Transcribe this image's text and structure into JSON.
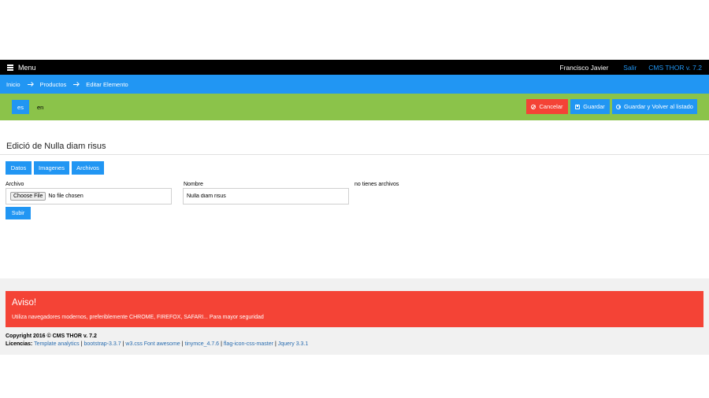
{
  "navbar": {
    "menu_label": "Menu",
    "user_name": "Francisco Javier",
    "logout_label": "Salir",
    "version_label": "CMS THOR v. 7.2",
    "link_color": "#2196f3"
  },
  "breadcrumb": {
    "items": [
      "Inicio",
      "Productos",
      "Editar Elemento"
    ],
    "bg_color": "#2196f3"
  },
  "actionbar": {
    "bg_color": "#8bc34a",
    "languages": [
      "es",
      "en"
    ],
    "active_language": "es",
    "cancel_label": "Cancelar",
    "save_label": "Guardar",
    "save_back_label": "Guardar y Volver al listado"
  },
  "main": {
    "title": "Edició de Nulla diam risus",
    "tabs": [
      "Datos",
      "Imagenes",
      "Archivos"
    ],
    "file_label": "Archivo",
    "file_button": "Choose File",
    "file_status": "No file chosen",
    "name_label": "Nombre",
    "name_value": "Nulla diam risus",
    "no_files_text": "no tienes archivos",
    "upload_label": "Subir"
  },
  "footer": {
    "alert_title": "Aviso!",
    "alert_text": "Utiliza navegadores modernos, preferiblemente CHROME, FIREFOX, SAFARI... Para mayor seguridad",
    "alert_color": "#f44336",
    "copyright": "Copyright 2016 © CMS THOR v. 7.2",
    "licenses_label": "Licencias:",
    "licenses": [
      "Template analytics",
      "bootstrap-3.3.7",
      "w3.css Font awesome",
      "tinymce_4.7.6",
      "flag-icon-css-master",
      "Jquery 3.3.1"
    ]
  }
}
